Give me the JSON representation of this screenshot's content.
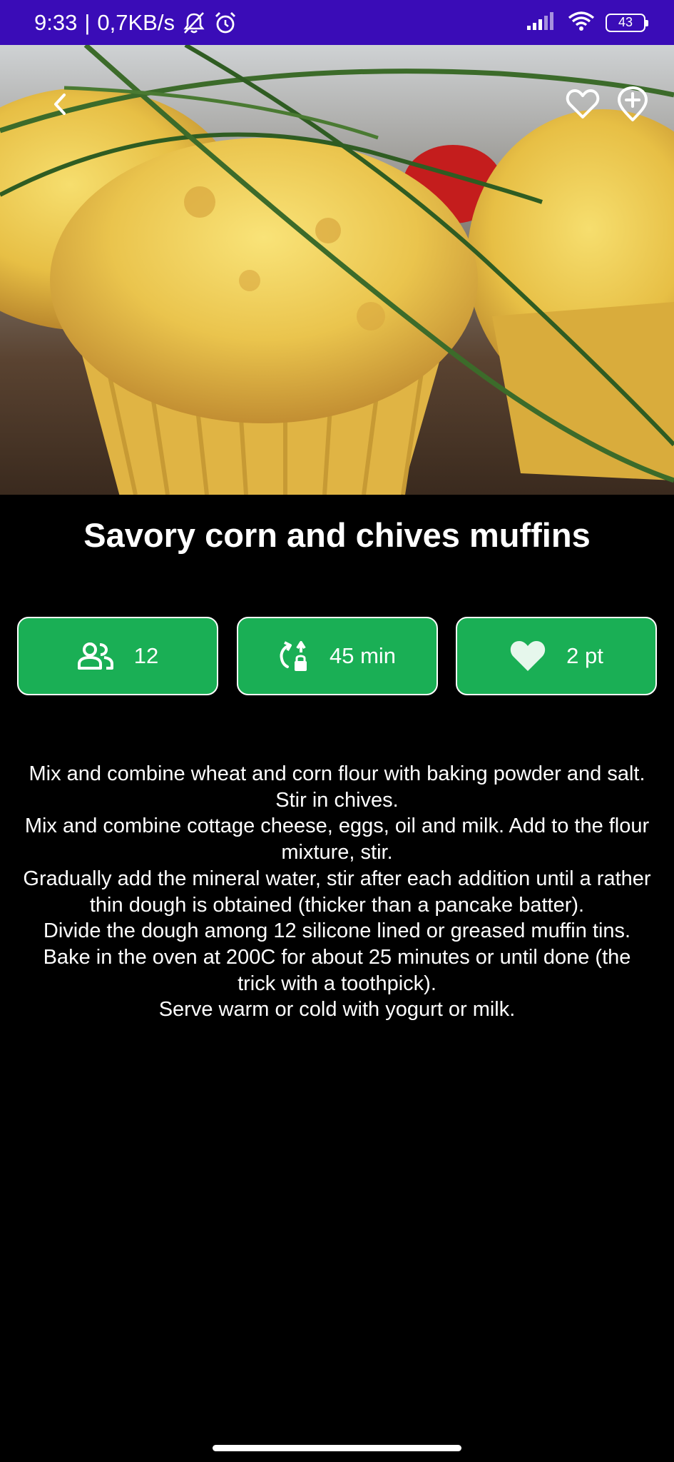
{
  "status_bar": {
    "time": "9:33",
    "separator": "|",
    "network_speed": "0,7KB/s",
    "battery_level": "43",
    "icons": [
      "mute-bell-icon",
      "alarm-icon",
      "signal-icon",
      "wifi-icon",
      "battery-icon"
    ]
  },
  "hero": {
    "image_subject": "corn and chives muffins photo",
    "buttons": [
      "back-icon",
      "heart-outline-icon",
      "add-circle-icon"
    ]
  },
  "recipe": {
    "title": "Savory corn and chives muffins",
    "servings": "12",
    "time": "45 min",
    "points": "2 pt",
    "instructions": [
      "Mix and combine wheat and corn flour with baking powder and salt. Stir in chives.",
      "Mix and combine cottage cheese, eggs, oil and milk. Add to the flour mixture, stir.",
      "Gradually add the mineral water, stir after each addition until a rather thin dough is obtained (thicker than a pancake batter).",
      "Divide the dough among 12 silicone lined or greased muffin tins.",
      "Bake in the oven at 200C for about 25 minutes or until done (the trick with a toothpick).",
      "Serve warm or cold with yogurt or milk."
    ]
  },
  "colors": {
    "status_bar": "#3a0cb7",
    "card_green": "#1aaf55",
    "background": "#000000",
    "text": "#ffffff"
  }
}
